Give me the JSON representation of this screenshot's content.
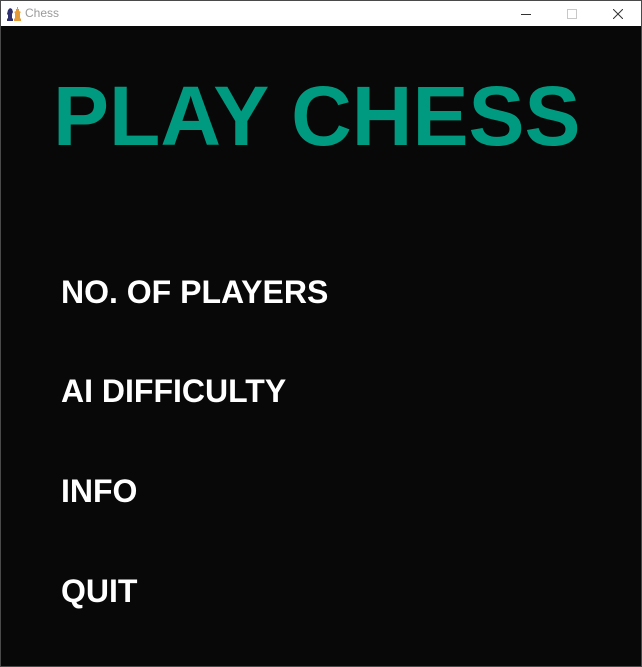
{
  "window": {
    "title": "Chess",
    "icon": "chess-pieces-icon",
    "controls": {
      "minimize_icon": "minimize-icon",
      "maximize_icon": "maximize-icon",
      "close_icon": "close-icon"
    }
  },
  "main": {
    "title": "PLAY CHESS",
    "menu": [
      {
        "label": "NO. OF PLAYERS"
      },
      {
        "label": "AI DIFFICULTY"
      },
      {
        "label": "INFO"
      },
      {
        "label": "QUIT"
      }
    ]
  },
  "colors": {
    "background": "#080808",
    "title": "#009a80",
    "menu_text": "#ffffff",
    "titlebar": "#ffffff"
  }
}
